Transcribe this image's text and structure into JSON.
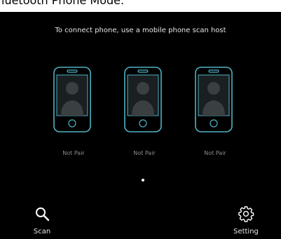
{
  "header": {
    "title": "luetooth Phone Mode."
  },
  "instruction": "To connect phone, use a mobile phone scan host",
  "phones": [
    {
      "status": "Not Pair"
    },
    {
      "status": "Not Pair"
    },
    {
      "status": "Not Pair"
    }
  ],
  "pager": {
    "current": 1,
    "total": 1
  },
  "actions": {
    "scan_label": "Scan",
    "setting_label": "Setting"
  },
  "colors": {
    "background": "#000000",
    "accent": "#4fb3c4",
    "text": "#e6e6e6",
    "muted": "#8c8c8c"
  },
  "icons": {
    "scan": "search-icon",
    "setting": "gear-icon",
    "phone": "phone-avatar-icon"
  }
}
